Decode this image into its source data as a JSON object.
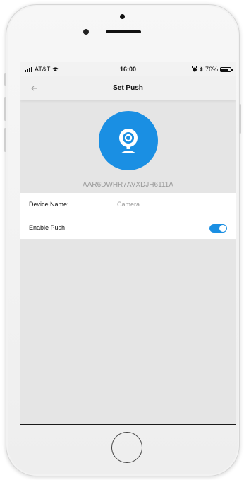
{
  "status_bar": {
    "carrier": "AT&T",
    "time": "16:00",
    "battery": "76%",
    "battery_level": 0.76
  },
  "nav": {
    "title": "Set Push"
  },
  "device": {
    "id": "AAR6DWHR7AVXDJH6111A",
    "icon": "webcam-icon"
  },
  "settings": {
    "device_name_label": "Device Name:",
    "device_name_value": "Camera",
    "enable_push_label": "Enable Push",
    "enable_push_on": true
  },
  "colors": {
    "accent": "#1a8fe3",
    "screen_background": "#e5e5e5",
    "secondary_text": "#9a9a9a"
  }
}
